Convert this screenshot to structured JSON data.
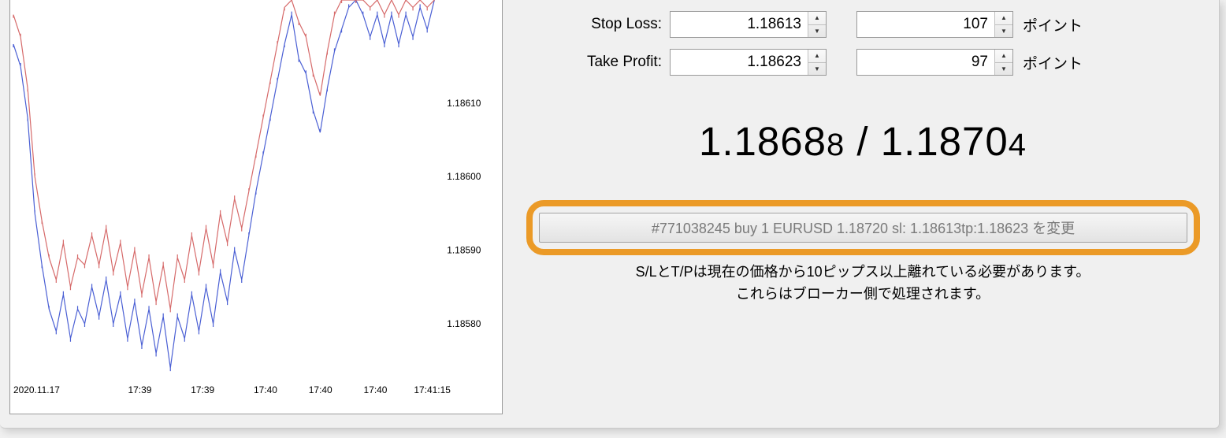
{
  "form": {
    "stop_loss": {
      "label": "Stop Loss:",
      "price": "1.18613",
      "points": "107",
      "unit": "ポイント"
    },
    "take_profit": {
      "label": "Take Profit:",
      "price": "1.18623",
      "points": "97",
      "unit": "ポイント"
    }
  },
  "price_quote": {
    "bid_main": "1.1868",
    "bid_sub": "8",
    "sep": " / ",
    "ask_main": "1.1870",
    "ask_sub": "4"
  },
  "modify_button": "#771038245 buy 1 EURUSD 1.18720 sl: 1.18613tp:1.18623 を変更",
  "notice_line1": "S/LとT/Pは現在の価格から10ピップス以上離れている必要があります。",
  "notice_line2": "これらはブローカー側で処理されます。",
  "chart_data": {
    "type": "line",
    "y_ticks": [
      "1.18610",
      "1.18600",
      "1.18590",
      "1.18580"
    ],
    "x_ticks": [
      "2020.11.17",
      "17:39",
      "17:39",
      "17:40",
      "17:40",
      "17:40",
      "17:41:15"
    ],
    "y_range": [
      1.18574,
      1.18624
    ],
    "series": [
      {
        "name": "bid",
        "color": "#4a5fd4",
        "values": [
          1.18618,
          1.18615,
          1.18608,
          1.18595,
          1.18588,
          1.18582,
          1.18579,
          1.18584,
          1.18578,
          1.18582,
          1.1858,
          1.18585,
          1.18581,
          1.18586,
          1.1858,
          1.18584,
          1.18578,
          1.18583,
          1.18577,
          1.18582,
          1.18576,
          1.18581,
          1.18574,
          1.18581,
          1.18578,
          1.18584,
          1.18579,
          1.18585,
          1.1858,
          1.18587,
          1.18583,
          1.1859,
          1.18586,
          1.18592,
          1.18598,
          1.18603,
          1.18608,
          1.18613,
          1.18618,
          1.18622,
          1.18616,
          1.18614,
          1.18609,
          1.18606,
          1.18612,
          1.18617,
          1.1862,
          1.18623,
          1.18624,
          1.18622,
          1.18619,
          1.18622,
          1.18618,
          1.18622,
          1.18618,
          1.18622,
          1.18619,
          1.18623,
          1.1862,
          1.18624
        ]
      },
      {
        "name": "ask",
        "color": "#d66a6a",
        "values": [
          1.18622,
          1.18619,
          1.18612,
          1.186,
          1.18594,
          1.18589,
          1.18586,
          1.18591,
          1.18585,
          1.18589,
          1.18588,
          1.18592,
          1.18588,
          1.18593,
          1.18587,
          1.18591,
          1.18585,
          1.1859,
          1.18584,
          1.18589,
          1.18583,
          1.18588,
          1.18582,
          1.18589,
          1.18586,
          1.18592,
          1.18587,
          1.18593,
          1.18588,
          1.18595,
          1.18591,
          1.18597,
          1.18593,
          1.18598,
          1.18603,
          1.18608,
          1.18613,
          1.18618,
          1.18623,
          1.18624,
          1.18621,
          1.18619,
          1.18614,
          1.18611,
          1.18617,
          1.18622,
          1.18624,
          1.18624,
          1.18624,
          1.18624,
          1.18623,
          1.18624,
          1.18622,
          1.18624,
          1.18622,
          1.18624,
          1.18623,
          1.18624,
          1.18623,
          1.18624
        ]
      }
    ]
  }
}
